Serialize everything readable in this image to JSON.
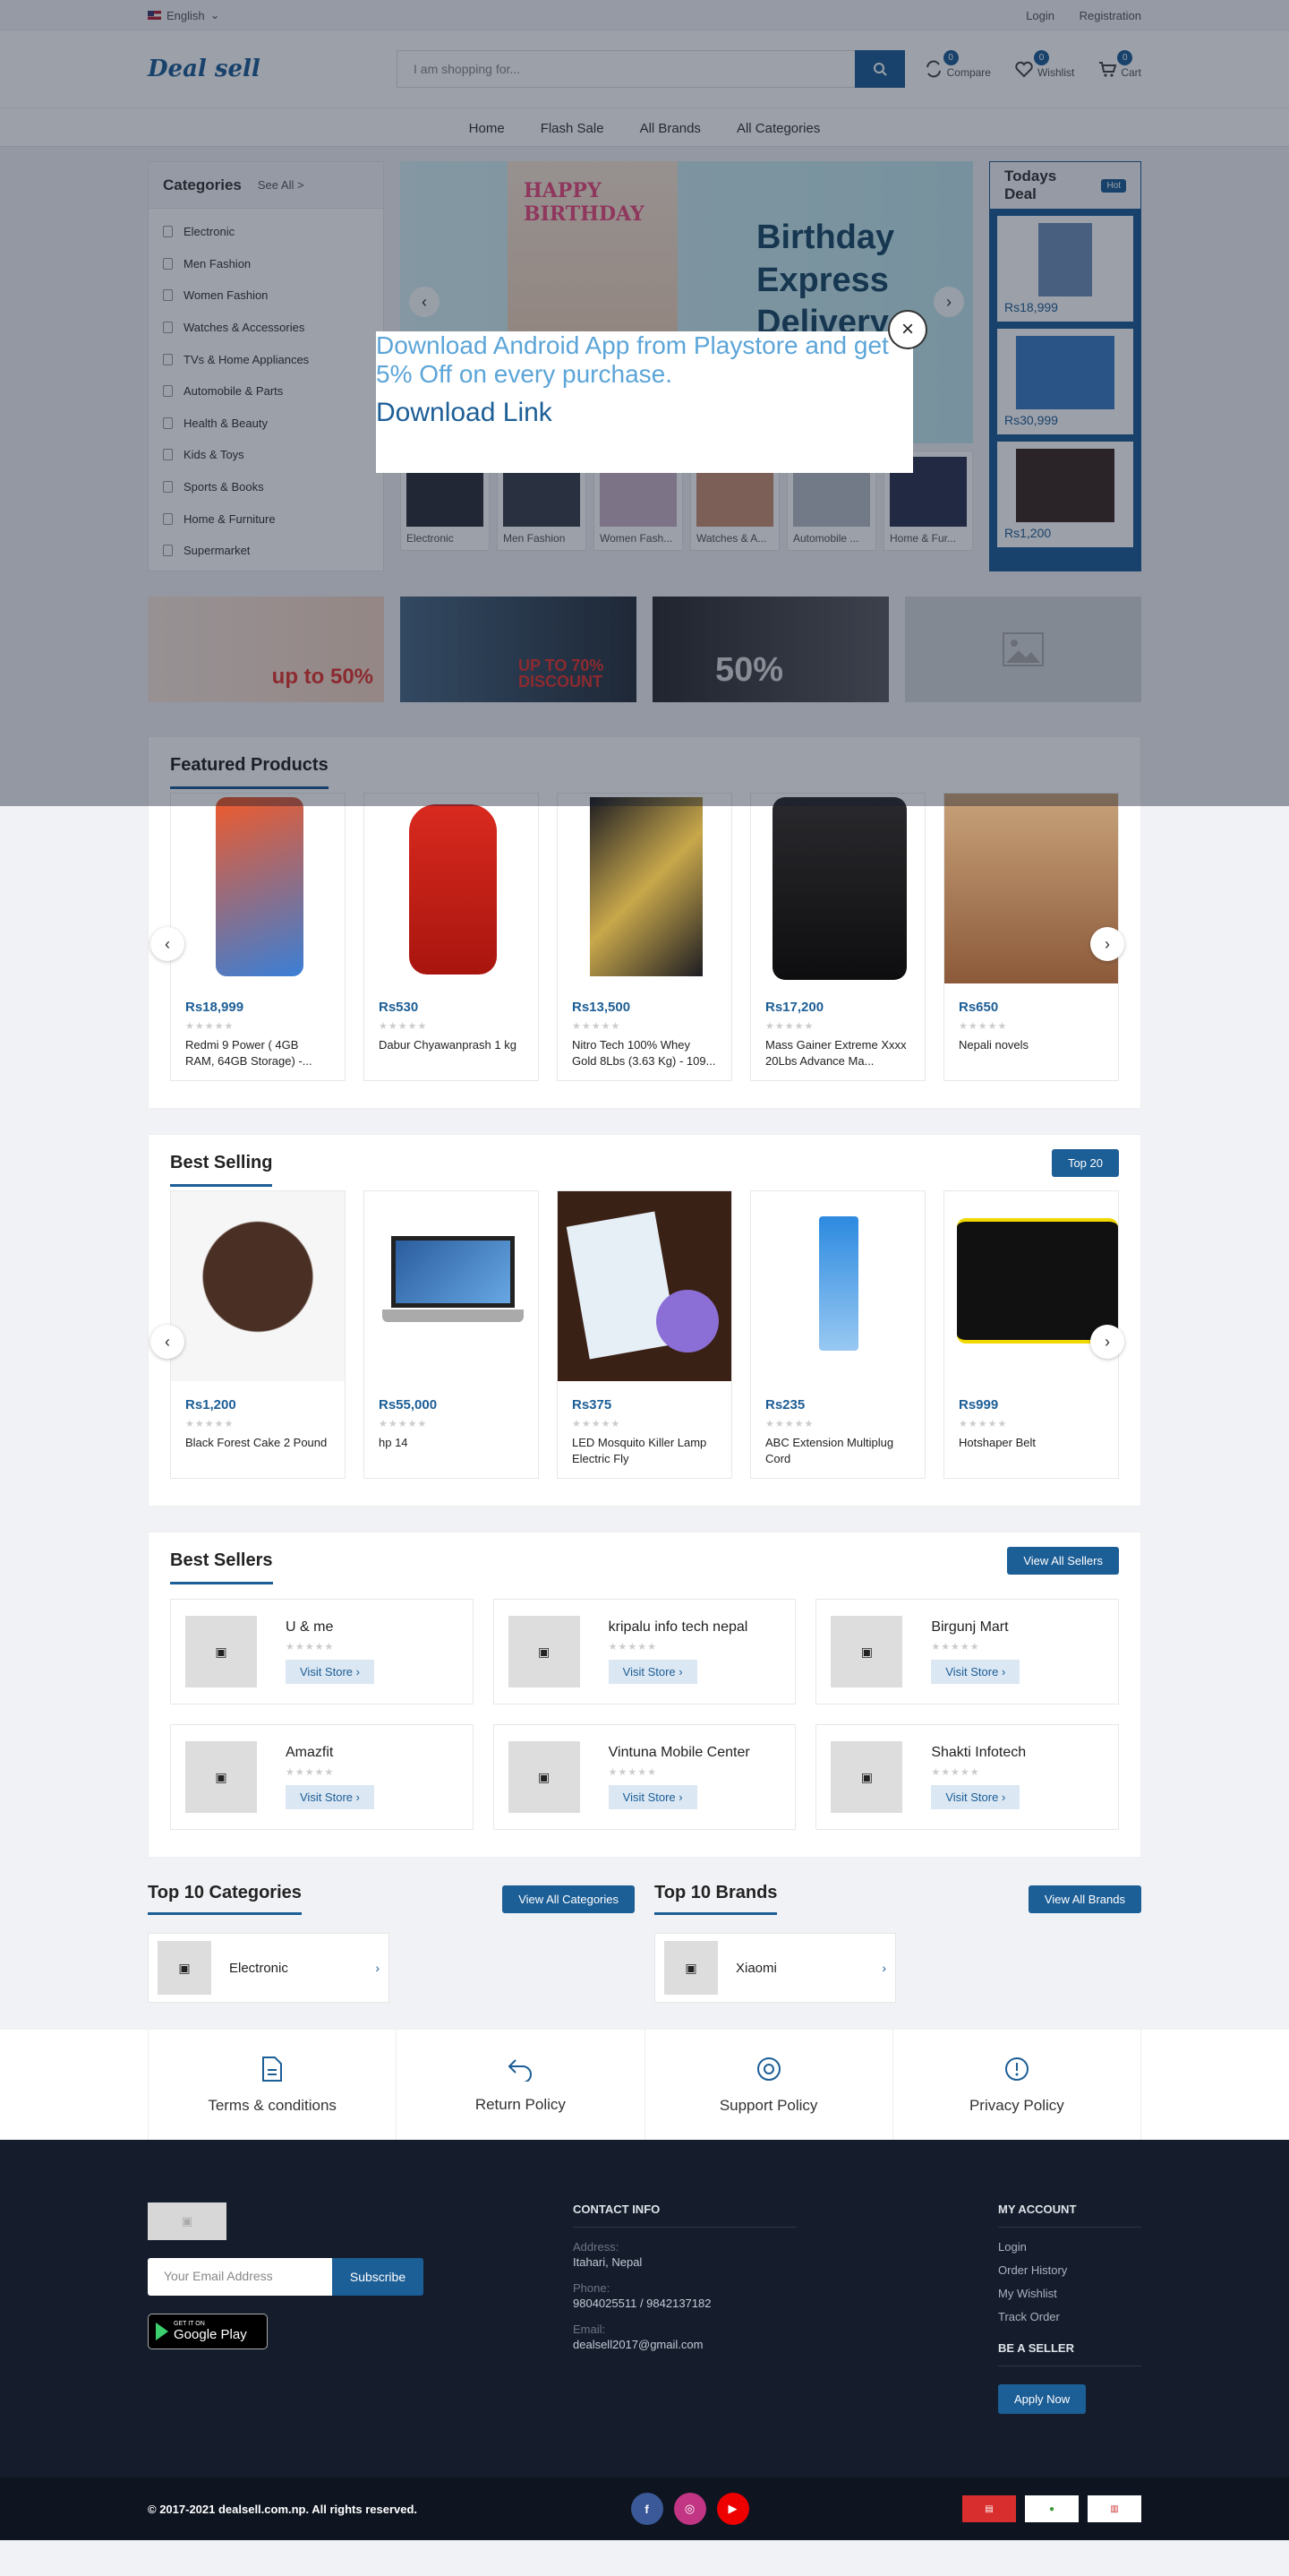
{
  "topbar": {
    "language": "English",
    "login": "Login",
    "register": "Registration"
  },
  "header": {
    "logo": "Deal sell",
    "search_placeholder": "I am shopping for...",
    "compare_label": "Compare",
    "compare_count": "0",
    "wishlist_label": "Wishlist",
    "wishlist_count": "0",
    "cart_label": "Cart",
    "cart_count": "0"
  },
  "nav": {
    "items": [
      "Home",
      "Flash Sale",
      "All Brands",
      "All Categories"
    ]
  },
  "categories": {
    "title": "Categories",
    "see_all": "See All >",
    "items": [
      "Electronic",
      "Men Fashion",
      "Women Fashion",
      "Watches & Accessories",
      "TVs & Home Appliances",
      "Automobile & Parts",
      "Health & Beauty",
      "Kids & Toys",
      "Sports & Books",
      "Home & Furniture",
      "Supermarket"
    ]
  },
  "slider": {
    "line1": "Birthday",
    "line2": "Express Delivery",
    "cake_text": "HAPPY BIRTHDAY"
  },
  "thumbs": [
    "Electronic",
    "Men Fashion",
    "Women Fash...",
    "Watches & A...",
    "Automobile ...",
    "Home & Fur..."
  ],
  "todays_deal": {
    "title": "Todays Deal",
    "badge": "Hot",
    "prices": [
      "Rs18,999",
      "Rs30,999",
      "Rs1,200"
    ]
  },
  "banners": [
    {
      "text": "up to 50%"
    },
    {
      "text": "UP TO 70% DISCOUNT"
    },
    {
      "text": "50%"
    }
  ],
  "featured": {
    "title": "Featured Products",
    "products": [
      {
        "price": "Rs18,999",
        "name": "Redmi 9 Power ( 4GB RAM, 64GB Storage) -..."
      },
      {
        "price": "Rs530",
        "name": "Dabur Chyawanprash 1 kg"
      },
      {
        "price": "Rs13,500",
        "name": "Nitro Tech 100% Whey Gold 8Lbs (3.63 Kg) - 109..."
      },
      {
        "price": "Rs17,200",
        "name": "Mass Gainer Extreme Xxxx 20Lbs Advance Ma..."
      },
      {
        "price": "Rs650",
        "name": "Nepali novels"
      }
    ]
  },
  "best_selling": {
    "title": "Best Selling",
    "button": "Top 20",
    "products": [
      {
        "price": "Rs1,200",
        "name": "Black Forest Cake 2 Pound"
      },
      {
        "price": "Rs55,000",
        "name": "hp 14"
      },
      {
        "price": "Rs375",
        "name": "LED Mosquito Killer Lamp Electric Fly"
      },
      {
        "price": "Rs235",
        "name": "ABC Extension Multiplug Cord"
      },
      {
        "price": "Rs999",
        "name": "Hotshaper Belt"
      }
    ]
  },
  "best_sellers": {
    "title": "Best Sellers",
    "button": "View All Sellers",
    "visit": "Visit Store",
    "sellers": [
      "U & me",
      "kripalu info tech nepal",
      "Birgunj Mart",
      "Amazfit",
      "Vintuna Mobile Center",
      "Shakti Infotech"
    ]
  },
  "top_categories": {
    "title": "Top 10 Categories",
    "button": "View All Categories",
    "item": "Electronic"
  },
  "top_brands": {
    "title": "Top 10 Brands",
    "button": "View All Brands",
    "item": "Xiaomi"
  },
  "policies": [
    "Terms & conditions",
    "Return Policy",
    "Support Policy",
    "Privacy Policy"
  ],
  "footer": {
    "email_placeholder": "Your Email Address",
    "subscribe": "Subscribe",
    "gplay_small": "GET IT ON",
    "gplay_big": "Google Play",
    "contact_title": "CONTACT INFO",
    "address_label": "Address:",
    "address": "Itahari, Nepal",
    "phone_label": "Phone:",
    "phone": "9804025511 / 9842137182",
    "email_label": "Email:",
    "email": "dealsell2017@gmail.com",
    "account_title": "MY ACCOUNT",
    "account_links": [
      "Login",
      "Order History",
      "My Wishlist",
      "Track Order"
    ],
    "seller_title": "BE A SELLER",
    "apply": "Apply Now",
    "copyright": "© 2017-2021 dealsell.com.np. All rights reserved."
  },
  "modal": {
    "text": "Download Android App from Playstore and get 5% Off on every purchase.",
    "link": "Download Link"
  }
}
